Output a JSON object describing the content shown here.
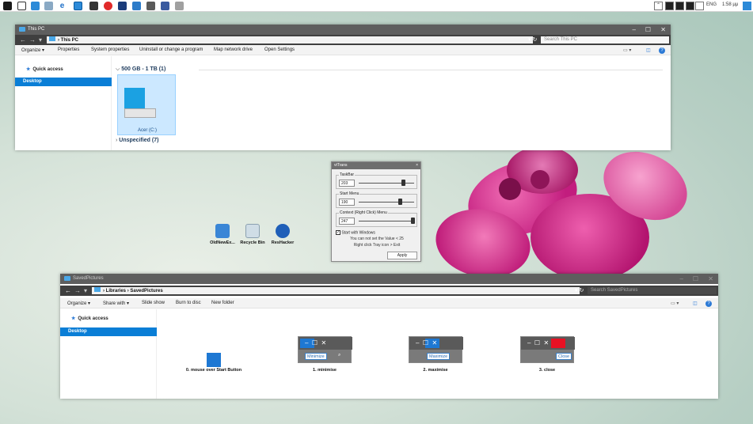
{
  "taskbar": {
    "tray_lang": "ENG",
    "clock": "1:58 μμ"
  },
  "this_pc": {
    "title": "This PC",
    "path": "This PC",
    "search_placeholder": "Search This PC",
    "menu": [
      "Organize ▾",
      "Properties",
      "System properties",
      "Uninstall or change a program",
      "Map network drive",
      "Open Settings"
    ],
    "sidebar_quick": "Quick access",
    "sidebar_desktop": "Desktop",
    "group1": "500 GB - 1 TB (1)",
    "drive_label": "Acer (C:)",
    "group2": "Unspecified (7)"
  },
  "vtrans": {
    "title": "vtTrans",
    "taskbar_label": "TaskBar",
    "taskbar_value": "203",
    "taskbar_level": 0.8,
    "start_label": "Start Menu",
    "start_value": "190",
    "start_level": 0.74,
    "context_label": "Context (Right Click) Menu",
    "context_value": "247",
    "context_level": 0.97,
    "checkbox_label": "Start with Windows",
    "note1": "You can not set the Value < 25",
    "note2": "Right click Tray icon > Exit",
    "apply": "Apply"
  },
  "desktop_icons": [
    "OldNewEx...",
    "Recycle Bin",
    "ResHacker"
  ],
  "saved": {
    "title": "SavedPictures",
    "path_lib": "Libraries",
    "path_folder": "SavedPictures",
    "search_placeholder": "Search SavedPictures",
    "menu": [
      "Organize ▾",
      "Share with ▾",
      "Slide show",
      "Burn to disc",
      "New folder"
    ],
    "sidebar_quick": "Quick access",
    "sidebar_desktop": "Desktop",
    "caption0": "0. mouse over Start Button",
    "caption1": "1. minimise",
    "caption2": "2. maximise",
    "caption3": "3. close",
    "tip_min": "Minimize",
    "tip_max": "Maximize",
    "tip_close": "Close"
  },
  "colors": {
    "accent": "#0a7ed6",
    "title_dark": "#5e5e5e",
    "close_red": "#e81123"
  }
}
